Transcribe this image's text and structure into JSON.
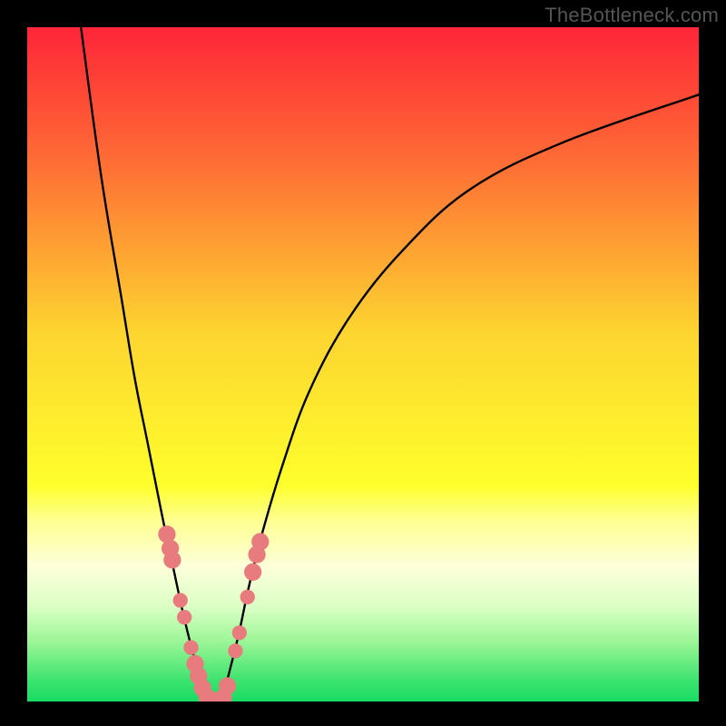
{
  "watermark": "TheBottleneck.com",
  "colors": {
    "black": "#000000",
    "curve": "#000000",
    "markers": "#e77b7d",
    "gradient_stops": [
      {
        "offset": 0.0,
        "color": "#fe2538"
      },
      {
        "offset": 0.2,
        "color": "#fe6d35"
      },
      {
        "offset": 0.45,
        "color": "#fdd430"
      },
      {
        "offset": 0.68,
        "color": "#feff2c"
      },
      {
        "offset": 0.73,
        "color": "#feff8f"
      },
      {
        "offset": 0.8,
        "color": "#fdffda"
      },
      {
        "offset": 0.86,
        "color": "#dbffc5"
      },
      {
        "offset": 0.91,
        "color": "#9df697"
      },
      {
        "offset": 0.97,
        "color": "#3be36e"
      },
      {
        "offset": 1.0,
        "color": "#19dc63"
      }
    ]
  },
  "chart_data": {
    "type": "line",
    "title": "",
    "xlabel": "",
    "ylabel": "",
    "xlim": [
      0,
      100
    ],
    "ylim": [
      0,
      100
    ],
    "grid": false,
    "legend": false,
    "series": [
      {
        "name": "left-branch",
        "x": [
          8.0,
          11.0,
          14.0,
          16.0,
          18.0,
          20.0,
          21.5,
          23.0,
          24.2,
          25.0,
          25.8,
          27.0
        ],
        "y": [
          100.0,
          78.0,
          60.0,
          48.0,
          38.0,
          28.0,
          21.0,
          14.0,
          9.0,
          6.0,
          3.0,
          0.0
        ]
      },
      {
        "name": "right-branch",
        "x": [
          29.0,
          30.0,
          31.5,
          33.0,
          35.0,
          38.0,
          42.0,
          48.0,
          56.0,
          66.0,
          80.0,
          100.0
        ],
        "y": [
          0.0,
          4.0,
          10.0,
          17.0,
          25.0,
          35.0,
          46.0,
          57.0,
          67.0,
          76.0,
          83.0,
          90.0
        ]
      }
    ],
    "markers": [
      {
        "x": 20.8,
        "y": 24.8,
        "r": 1.3
      },
      {
        "x": 21.3,
        "y": 22.7,
        "r": 1.3
      },
      {
        "x": 21.6,
        "y": 21.0,
        "r": 1.3
      },
      {
        "x": 22.8,
        "y": 15.0,
        "r": 1.1
      },
      {
        "x": 23.4,
        "y": 12.5,
        "r": 1.1
      },
      {
        "x": 24.4,
        "y": 8.0,
        "r": 1.1
      },
      {
        "x": 25.0,
        "y": 5.6,
        "r": 1.3
      },
      {
        "x": 25.5,
        "y": 3.8,
        "r": 1.3
      },
      {
        "x": 26.1,
        "y": 2.0,
        "r": 1.3
      },
      {
        "x": 26.8,
        "y": 0.6,
        "r": 1.3
      },
      {
        "x": 28.0,
        "y": 0.3,
        "r": 1.1
      },
      {
        "x": 29.2,
        "y": 0.6,
        "r": 1.3
      },
      {
        "x": 29.8,
        "y": 2.3,
        "r": 1.3
      },
      {
        "x": 31.0,
        "y": 7.5,
        "r": 1.1
      },
      {
        "x": 31.6,
        "y": 10.2,
        "r": 1.1
      },
      {
        "x": 32.8,
        "y": 15.5,
        "r": 1.1
      },
      {
        "x": 33.6,
        "y": 19.2,
        "r": 1.3
      },
      {
        "x": 34.2,
        "y": 21.8,
        "r": 1.3
      },
      {
        "x": 34.7,
        "y": 23.7,
        "r": 1.3
      }
    ]
  }
}
